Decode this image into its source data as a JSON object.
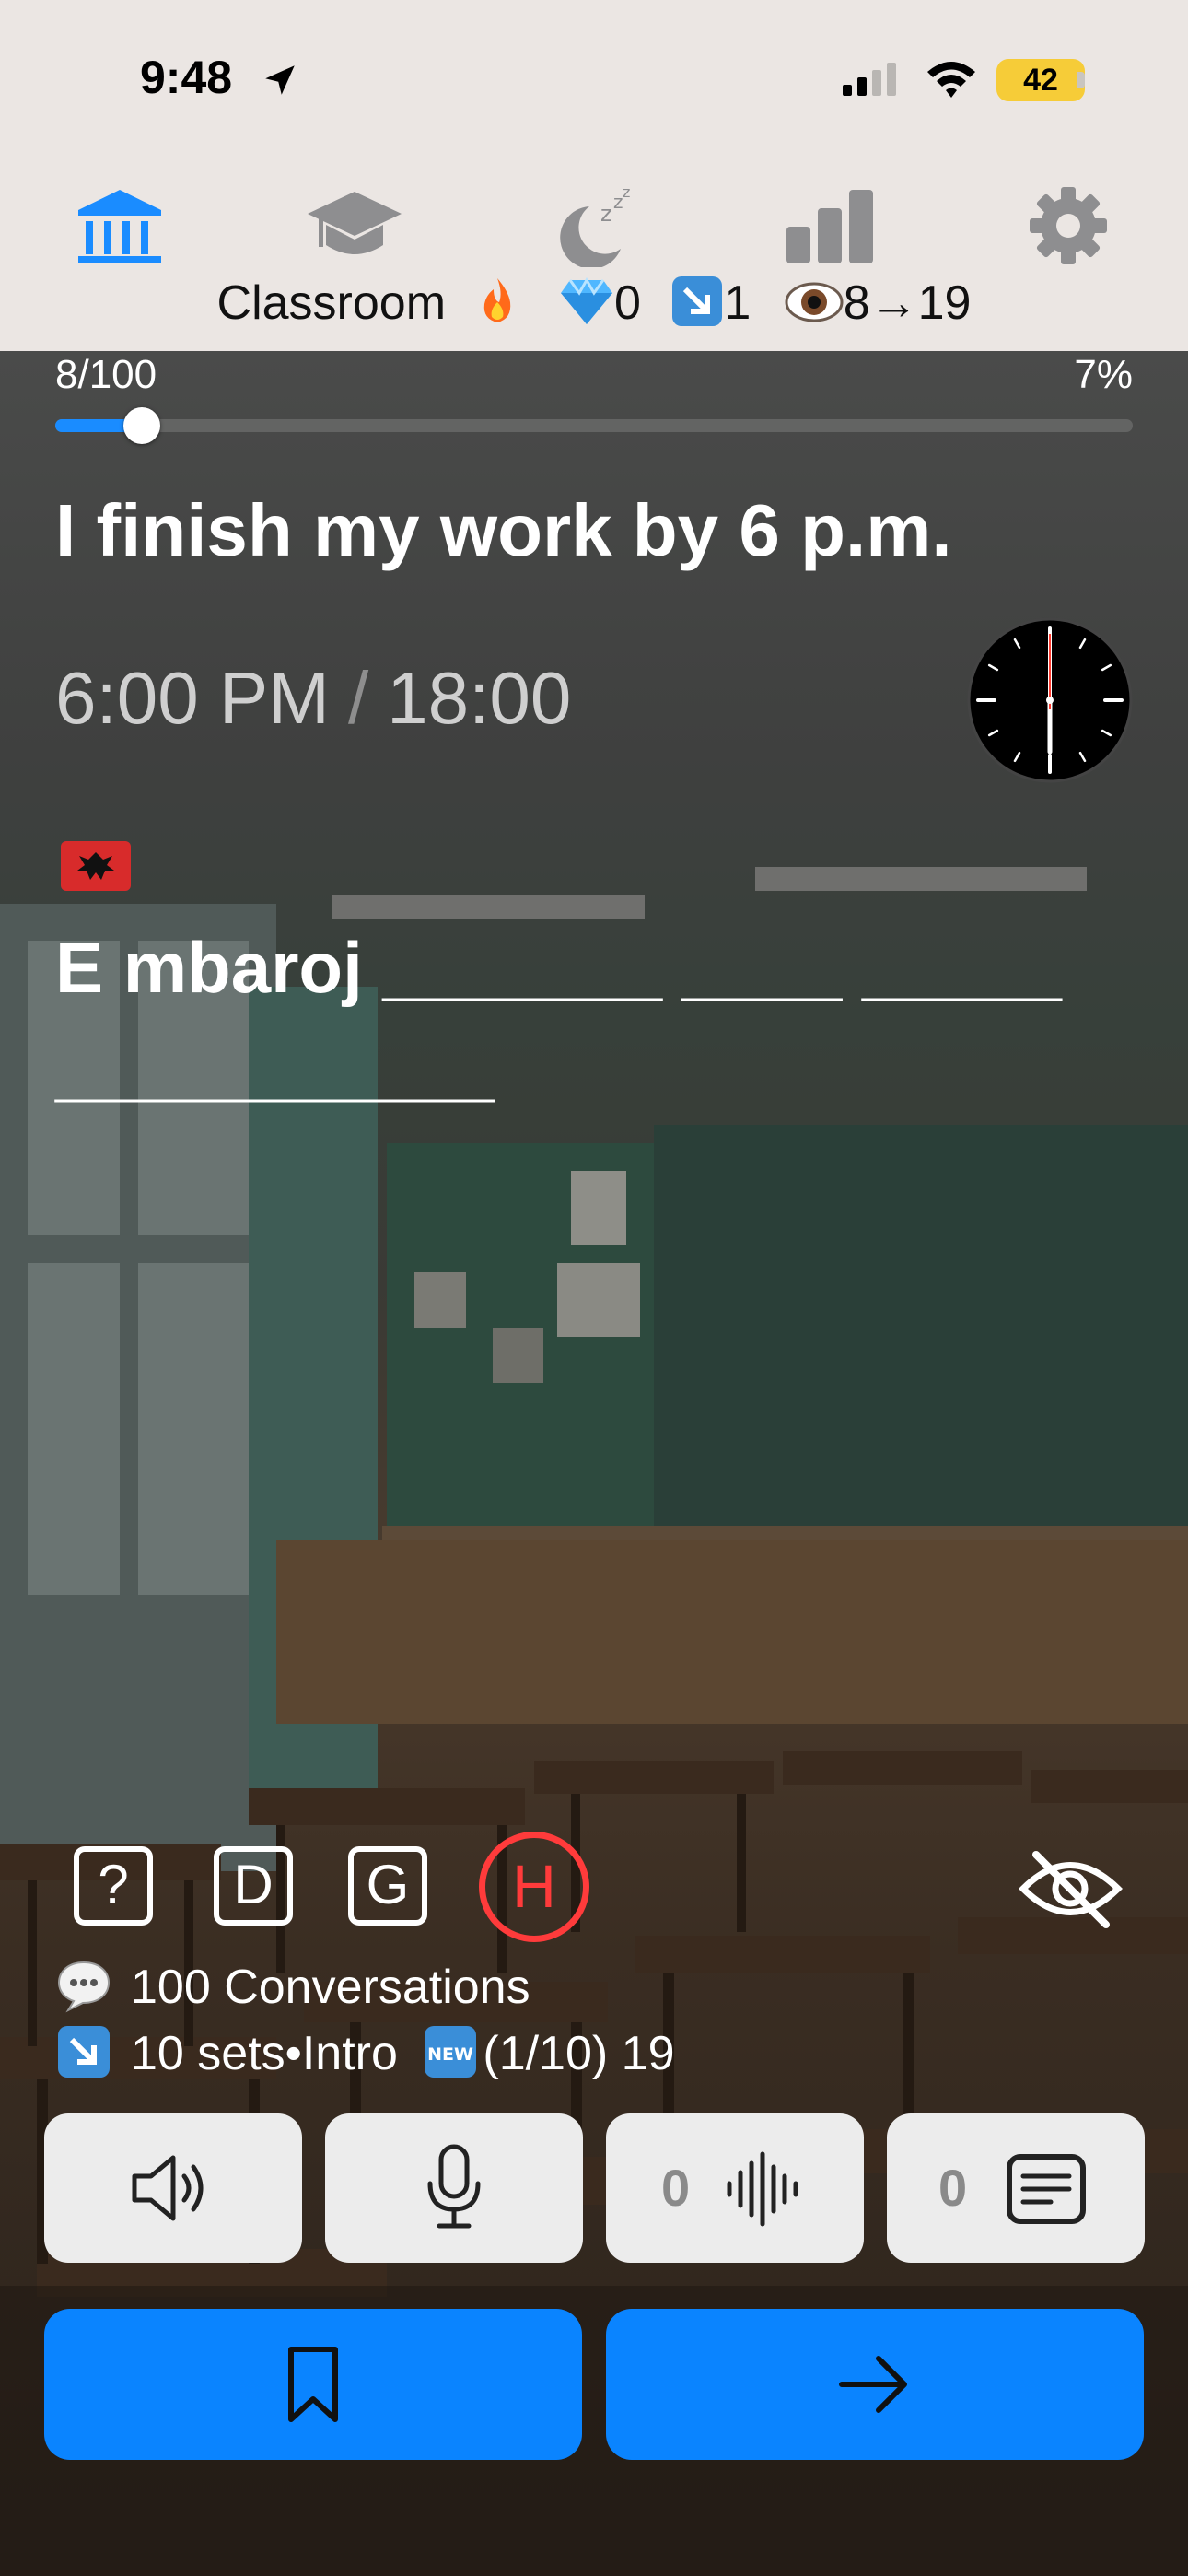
{
  "status_bar": {
    "time": "9:48",
    "battery": "42"
  },
  "nav": {
    "title": "Classroom",
    "stats": {
      "streak_icon": "fire-emoji",
      "gems": "0",
      "sets_icon": "down-right-arrow-emoji",
      "sets": "1",
      "views_icon": "eye-emoji",
      "views": "8→19"
    },
    "icons": [
      "classroom-icon",
      "graduation-cap-icon",
      "sleep-moon-icon",
      "bar-chart-icon",
      "gear-icon"
    ],
    "active_color": "#1a8cff"
  },
  "progress": {
    "count": "8/100",
    "percent_label": "7%",
    "fraction": 0.08
  },
  "card": {
    "sentence": "I finish my work by 6 p.m.",
    "time_12h": "6:00 PM",
    "time_separator": "/",
    "time_24h": "18:00",
    "flag": "albania-flag",
    "cloze_word": "E mbaroj",
    "cloze_blanks": [
      "_______",
      "____",
      "_____",
      "___________"
    ]
  },
  "tools": {
    "letters": [
      "?",
      "D",
      "G"
    ],
    "highlight": "H",
    "highlight_color": "#ff3b3b"
  },
  "info": {
    "conversations": "100 Conversations",
    "sets_line": "10 sets•Intro",
    "new_badge": "NEW",
    "sets_tail": "(1/10) 19"
  },
  "actions": {
    "speaker_icon": "speaker-icon",
    "mic_icon": "microphone-icon",
    "waveform_count": "0",
    "notes_count": "0"
  },
  "colors": {
    "primary": "#0a84ff",
    "button_light": "#ececec"
  }
}
